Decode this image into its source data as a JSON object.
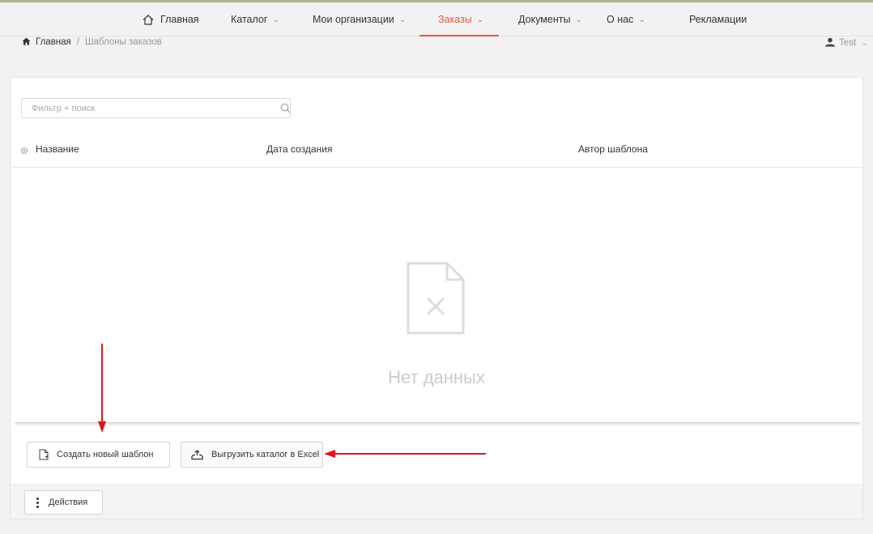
{
  "nav": {
    "items": [
      {
        "label": "Главная",
        "has_dropdown": false,
        "icon": "home-outline-icon"
      },
      {
        "label": "Каталог",
        "has_dropdown": true
      },
      {
        "label": "Мои организации",
        "has_dropdown": true
      },
      {
        "label": "Заказы",
        "has_dropdown": true,
        "active": true
      },
      {
        "label": "Документы",
        "has_dropdown": true
      },
      {
        "label": "О нас",
        "has_dropdown": true
      },
      {
        "label": "Рекламации",
        "has_dropdown": false
      }
    ],
    "dropdown_glyph": "⌄"
  },
  "breadcrumb": {
    "home": "Главная",
    "separator": "/",
    "current": "Шаблоны заказов"
  },
  "user": {
    "name": "Test"
  },
  "filter": {
    "placeholder": "Фильтр + поиск",
    "value": ""
  },
  "table": {
    "columns": [
      "Название",
      "Дата создания",
      "Автор шаблона"
    ],
    "rows": [],
    "empty_text": "Нет данных"
  },
  "buttons": {
    "create_template": "Создать новый шаблон",
    "export_catalog": "Выгрузить каталог в Excel",
    "actions": "Действия"
  },
  "colors": {
    "accent": "#e9573f",
    "top_bar": "#a7b98a",
    "annotation_arrow": "#e0161c"
  }
}
